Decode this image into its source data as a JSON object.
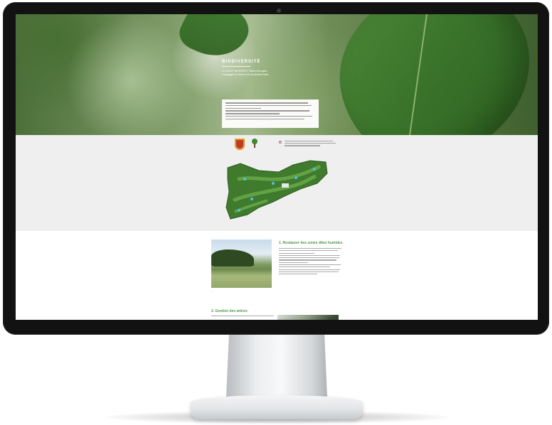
{
  "hero": {
    "title": "BIODIVERSITÉ",
    "subtitle_line1": "Le GOLF de BUSSY Saint-Georges",
    "subtitle_line2": "s'engage en faveur de la biodiversité."
  },
  "sections": [
    {
      "title": "1. Restaurer des zones dites humides"
    },
    {
      "title": "2. Gestion des arbres"
    }
  ],
  "icons": [
    "golf-club-logo-icon",
    "tree-logo-icon",
    "info-icon",
    "camera-icon"
  ],
  "colors": {
    "accent_green": "#4e9a4a",
    "band_grey": "#efefef",
    "bezel": "#121212"
  }
}
